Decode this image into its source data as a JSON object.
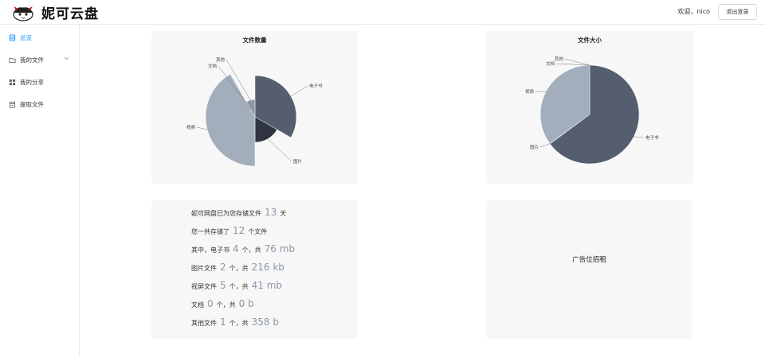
{
  "app": {
    "title": "妮可云盘"
  },
  "header": {
    "welcome_prefix": "欢迎，",
    "username": "nico",
    "logout_label": "退出登录"
  },
  "sidebar": {
    "items": [
      {
        "label": "总览",
        "icon": "dashboard-icon",
        "active": true
      },
      {
        "label": "我的文件",
        "icon": "folder-icon",
        "active": false
      },
      {
        "label": "我的分享",
        "icon": "grid-icon",
        "active": false
      },
      {
        "label": "提取文件",
        "icon": "inbox-icon",
        "active": false
      }
    ]
  },
  "chart_data": [
    {
      "type": "pie",
      "title": "文件数量",
      "categories": [
        "电子书",
        "图片",
        "视频",
        "文档",
        "其他"
      ],
      "values": [
        4,
        2,
        5,
        0,
        1
      ]
    },
    {
      "type": "pie",
      "title": "文件大小",
      "categories": [
        "电子书",
        "图片",
        "视频",
        "文档",
        "其他"
      ],
      "values": [
        76,
        0.216,
        41,
        0,
        0.000358
      ],
      "unit": "mb"
    }
  ],
  "colors": {
    "ebook": "#545e6f",
    "image": "#2f3440",
    "video": "#a3aebc",
    "doc": "#c2c9d3",
    "other": "#8d97a5",
    "stat_number": "#8a97a8"
  },
  "stats": {
    "days": {
      "prefix": "妮可网盘已为您存储文件",
      "value": "13",
      "suffix": "天"
    },
    "total": {
      "prefix": "您一共存储了",
      "value": "12",
      "suffix": "个文件"
    },
    "ebook": {
      "prefix": "其中，电子书",
      "count": "4",
      "mid": "个，共",
      "size": "76 mb"
    },
    "image": {
      "prefix": "图片文件",
      "count": "2",
      "mid": "个，共",
      "size": "216 kb"
    },
    "video": {
      "prefix": "视屏文件",
      "count": "5",
      "mid": "个，共",
      "size": "41 mb"
    },
    "doc": {
      "prefix": "文档",
      "count": "0",
      "mid": "个，共",
      "size": "0 b"
    },
    "other": {
      "prefix": "其他文件",
      "count": "1",
      "mid": "个，共",
      "size": "358 b"
    }
  },
  "ad": {
    "text": "广告位招租"
  }
}
